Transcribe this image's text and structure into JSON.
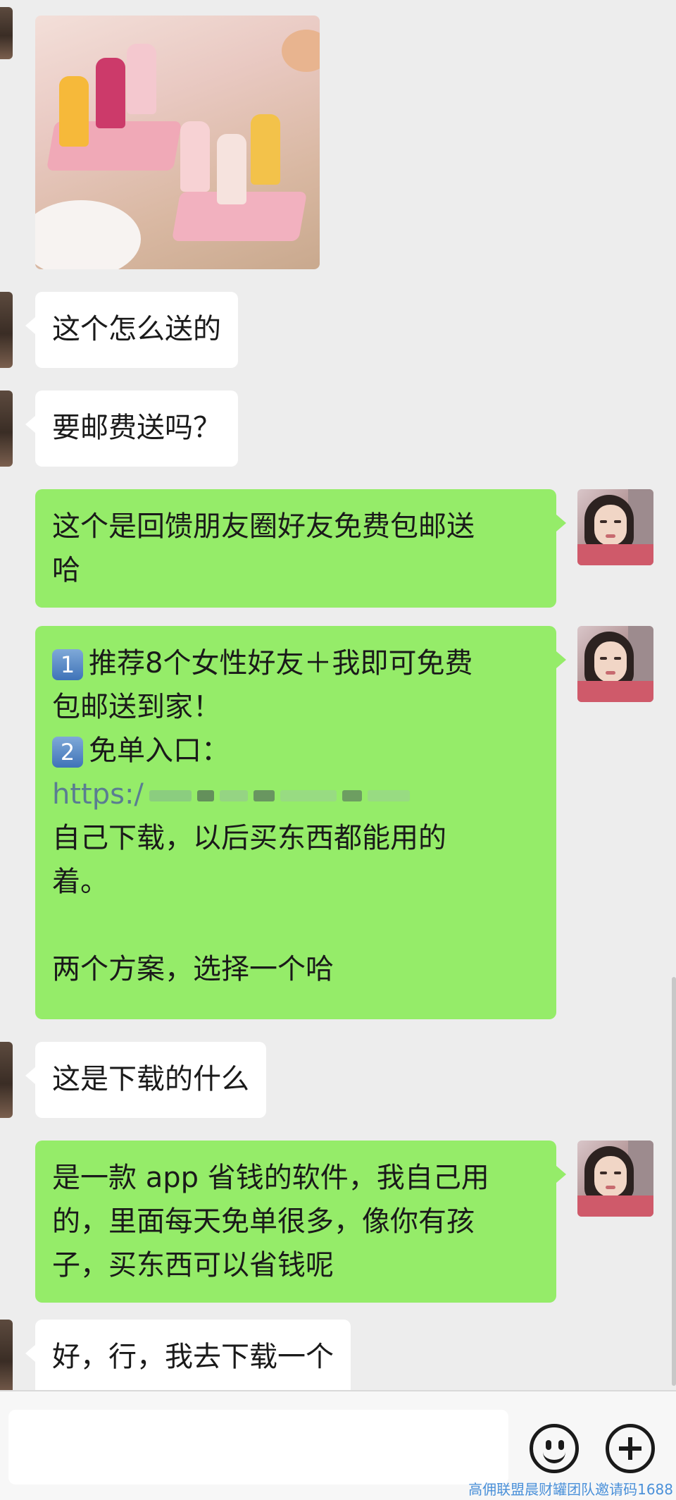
{
  "messages": {
    "m1": "这个怎么送的",
    "m2": "要邮费送吗？",
    "m3_lines": [
      "这个是回馈朋友圈好友免费包邮送",
      "哈"
    ],
    "m4": {
      "badge1": "1",
      "line1": "推荐8个女性好友＋我即可免费",
      "line2": "包邮送到家！",
      "badge2": "2",
      "line3": "免单入口：",
      "link_prefix": "https:/",
      "line4": "自己下载，以后买东西都能用的",
      "line5": "着。",
      "line6": "两个方案，选择一个哈"
    },
    "m5": "这是下载的什么",
    "m6_lines": [
      "是一款 app 省钱的软件，我自己用",
      "的，里面每天免单很多，像你有孩",
      "子，买东西可以省钱呢"
    ],
    "m7": "好，行，我去下载一个"
  },
  "input": {
    "placeholder": ""
  },
  "icons": {
    "emoji": "emoji-icon",
    "plus": "plus-icon"
  },
  "watermark": "高佣联盟晨财罐团队邀请码1688",
  "colors": {
    "outgoing": "#95ec69",
    "incoming": "#ffffff",
    "background": "#ededed"
  }
}
